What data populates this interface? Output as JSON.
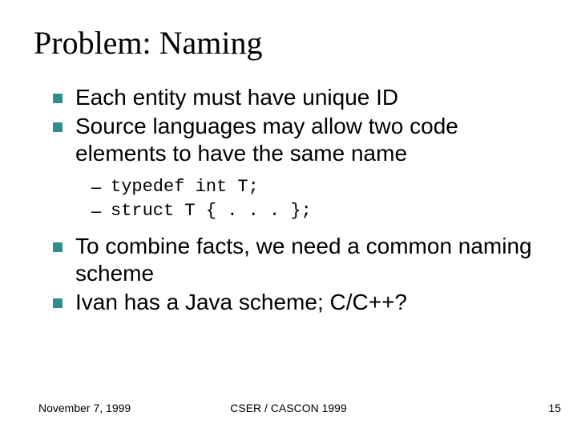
{
  "title": "Problem: Naming",
  "bullets": {
    "b1": "Each entity must have unique ID",
    "b2": "Source languages may allow two code elements to have the same name",
    "b3": "To combine facts, we need a common naming scheme",
    "b4": "Ivan has a Java scheme; C/C++?"
  },
  "code": {
    "c1": "typedef int T;",
    "c2": "struct T { . . . };"
  },
  "footer": {
    "date": "November 7, 1999",
    "center": "CSER / CASCON 1999",
    "page": "15"
  }
}
